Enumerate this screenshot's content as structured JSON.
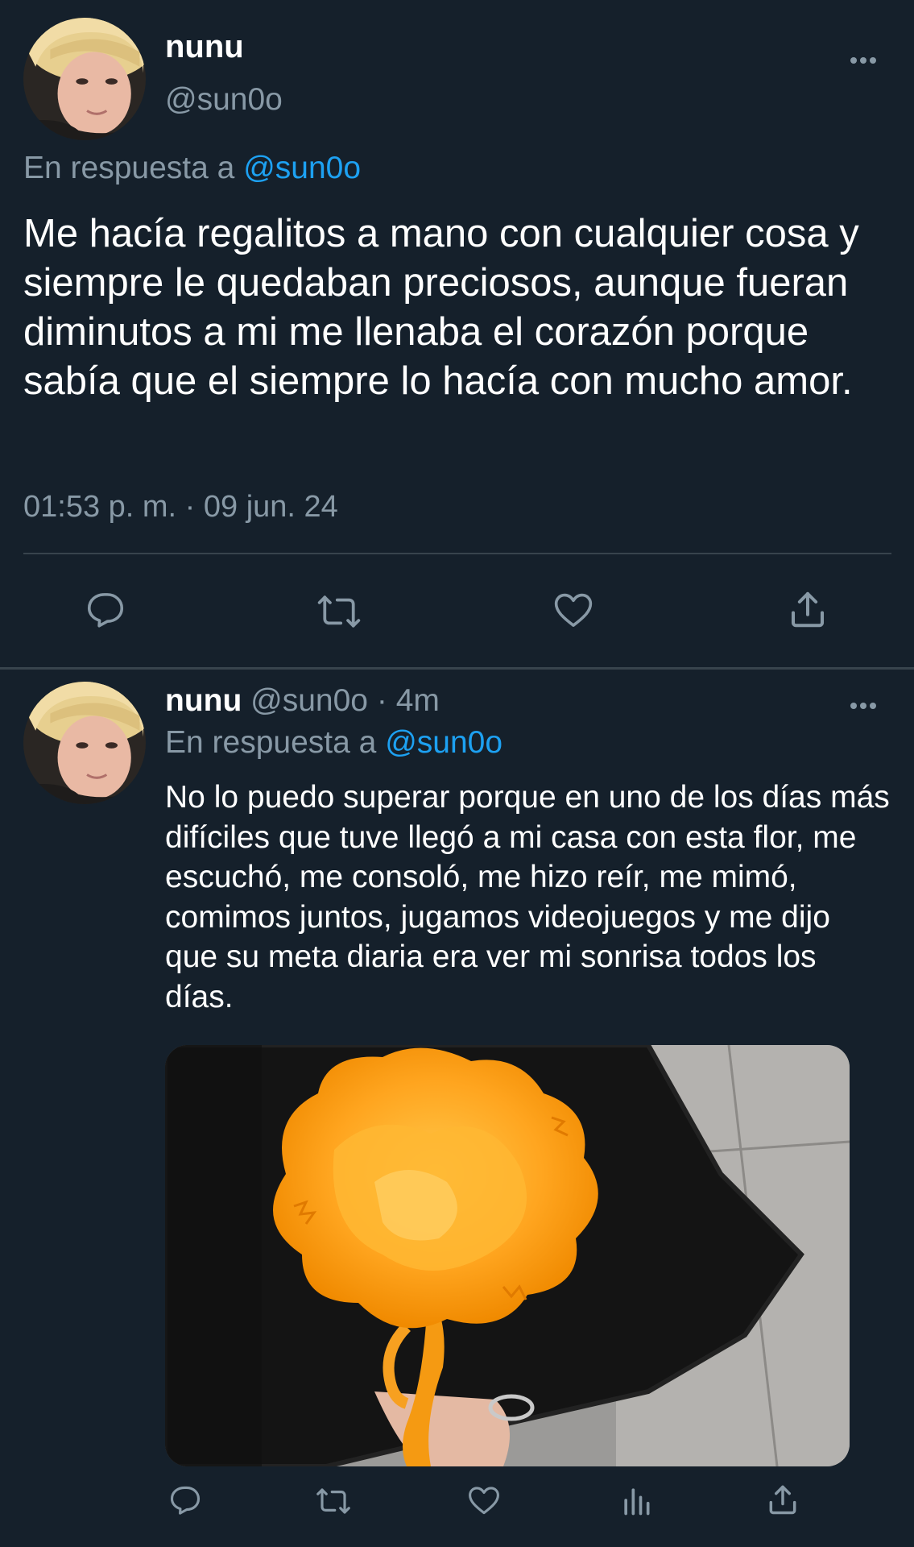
{
  "main_tweet": {
    "display_name": "nunu",
    "handle": "@sun0o",
    "reply_prefix": "En respuesta a",
    "reply_handle": "@sun0o",
    "text": "Me hacía regalitos a mano con cualquier cosa y siempre le quedaban preciosos, aunque fueran diminutos a mi me llenaba el corazón porque sabía que el siempre lo hacía con mucho amor.",
    "timestamp": "01:53 p. m. · 09 jun. 24",
    "actions": [
      {
        "icon": "reply-icon"
      },
      {
        "icon": "retweet-icon"
      },
      {
        "icon": "like-icon"
      },
      {
        "icon": "share-icon"
      }
    ]
  },
  "reply_tweet": {
    "display_name": "nunu",
    "handle": "@sun0o",
    "separator": "·",
    "age": "4m",
    "reply_prefix": "En respuesta a",
    "reply_handle": "@sun0o",
    "text": "No lo puedo superar porque en uno de los días más difíciles que tuve llegó a mi casa con esta flor, me escuchó, me consoló, me hizo reír, me mimó, comimos juntos, jugamos videojuegos y me dijo que su meta diaria era ver mi sonrisa todos los días.",
    "media_icon": "orange-flower-photo",
    "actions": [
      {
        "icon": "reply-icon"
      },
      {
        "icon": "retweet-icon"
      },
      {
        "icon": "like-icon"
      },
      {
        "icon": "analytics-icon"
      },
      {
        "icon": "share-icon"
      }
    ]
  },
  "colors": {
    "background": "#15202b",
    "text": "#ffffff",
    "muted": "#8899a6",
    "link": "#1da1f2",
    "divider": "#38444d"
  }
}
